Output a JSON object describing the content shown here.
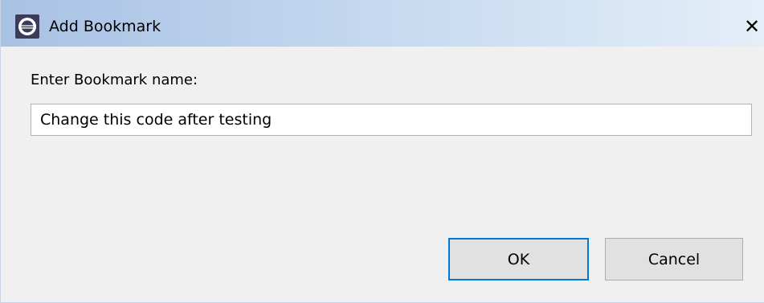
{
  "window": {
    "title": "Add Bookmark",
    "icon": "eclipse-app-icon",
    "close_label": "✕"
  },
  "form": {
    "prompt_label": "Enter Bookmark name:",
    "name_value": "Change this code after testing"
  },
  "buttons": {
    "ok_label": "OK",
    "cancel_label": "Cancel"
  },
  "colors": {
    "titlebar_start": "#a8c2e4",
    "titlebar_end": "#e4eef8",
    "dialog_background": "#f0f0f0",
    "default_button_border": "#0078d7"
  }
}
